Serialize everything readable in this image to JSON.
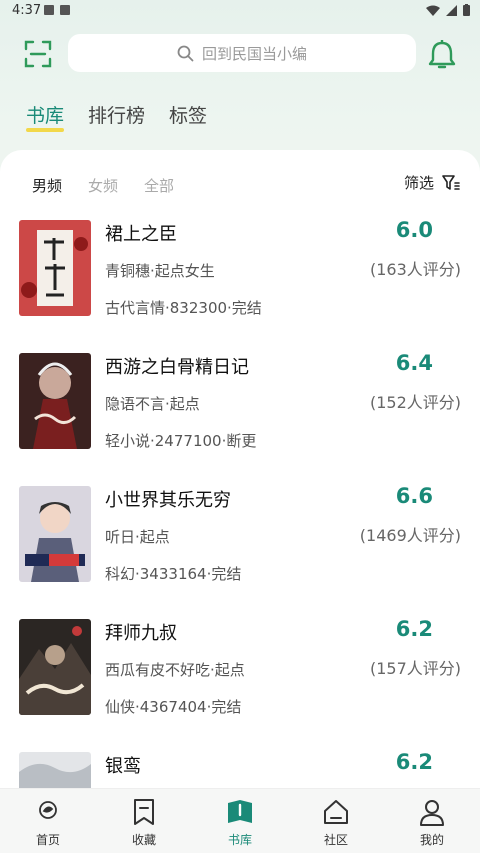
{
  "status": {
    "time": "4:37"
  },
  "search": {
    "placeholder": "回到民国当小编"
  },
  "top_tabs": [
    {
      "label": "书库",
      "active": true
    },
    {
      "label": "排行榜",
      "active": false
    },
    {
      "label": "标签",
      "active": false
    }
  ],
  "sub_tabs": [
    {
      "label": "男频",
      "active": true
    },
    {
      "label": "女频",
      "active": false
    },
    {
      "label": "全部",
      "active": false
    }
  ],
  "filter_label": "筛选",
  "books": [
    {
      "title": "裙上之臣",
      "author": "青铜穗·起点女生",
      "meta": "古代言情·832300·完结",
      "score": "6.0",
      "count": "(163人评分)",
      "cover_color": "#c42b2b"
    },
    {
      "title": "西游之白骨精日记",
      "author": "隐语不言·起点",
      "meta": "轻小说·2477100·断更",
      "score": "6.4",
      "count": "(152人评分)",
      "cover_color": "#4a2a24"
    },
    {
      "title": "小世界其乐无穷",
      "author": "听日·起点",
      "meta": "科幻·3433164·完结",
      "score": "6.6",
      "count": "(1469人评分)",
      "cover_color": "#6d6f82"
    },
    {
      "title": "拜师九叔",
      "author": "西瓜有皮不好吃·起点",
      "meta": "仙侠·4367404·完结",
      "score": "6.2",
      "count": "(157人评分)",
      "cover_color": "#2e2a26"
    },
    {
      "title": "银鸾",
      "author": "",
      "meta": "",
      "score": "6.2",
      "count": "",
      "cover_color": "#c9cdd2"
    }
  ],
  "bottom_nav": [
    {
      "label": "首页",
      "icon": "home-icon",
      "active": false
    },
    {
      "label": "收藏",
      "icon": "bookmark-icon",
      "active": false
    },
    {
      "label": "书库",
      "icon": "library-icon",
      "active": true
    },
    {
      "label": "社区",
      "icon": "community-icon",
      "active": false
    },
    {
      "label": "我的",
      "icon": "profile-icon",
      "active": false
    }
  ],
  "colors": {
    "accent": "#1a8a78",
    "tab_underline": "#f2d84a"
  }
}
